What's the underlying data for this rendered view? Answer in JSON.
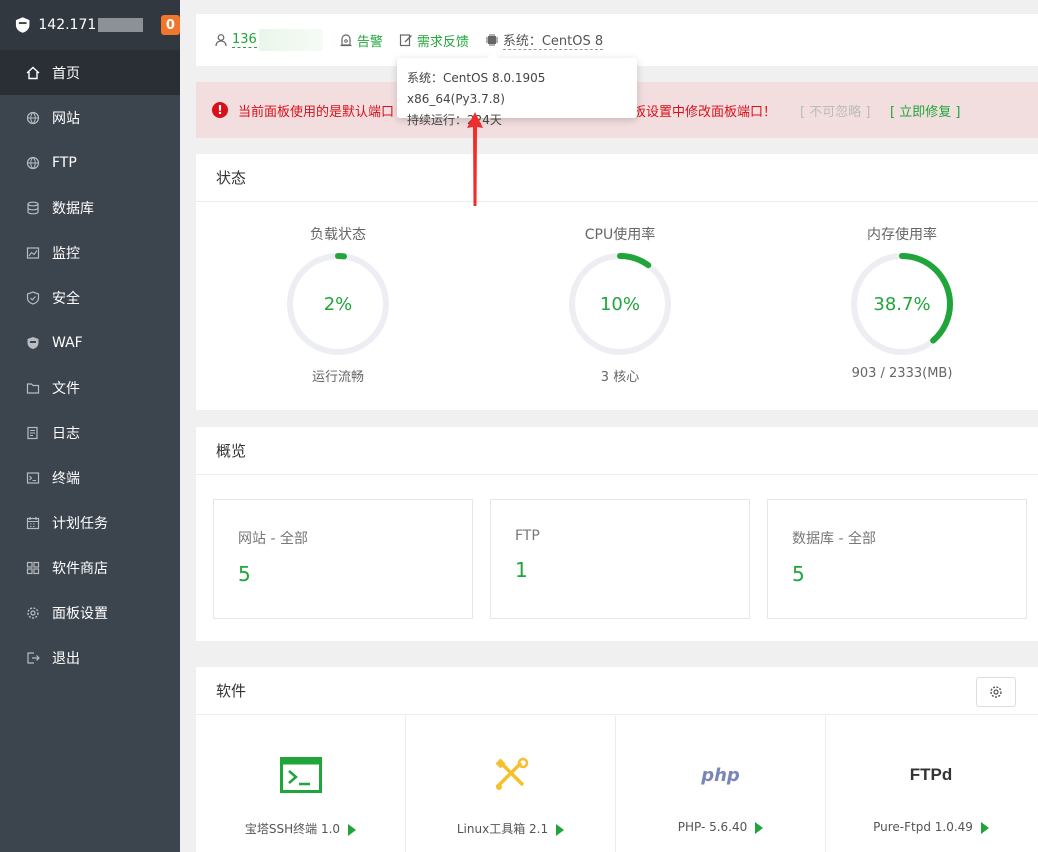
{
  "sidebar": {
    "ip": "142.171",
    "badge": "0",
    "items": [
      {
        "label": "首页",
        "icon": "home-icon"
      },
      {
        "label": "网站",
        "icon": "globe-icon"
      },
      {
        "label": "FTP",
        "icon": "globe-icon"
      },
      {
        "label": "数据库",
        "icon": "database-icon"
      },
      {
        "label": "监控",
        "icon": "monitor-icon"
      },
      {
        "label": "安全",
        "icon": "shield-icon"
      },
      {
        "label": "WAF",
        "icon": "waf-icon"
      },
      {
        "label": "文件",
        "icon": "folder-icon"
      },
      {
        "label": "日志",
        "icon": "log-icon"
      },
      {
        "label": "终端",
        "icon": "terminal-icon"
      },
      {
        "label": "计划任务",
        "icon": "calendar-icon"
      },
      {
        "label": "软件商店",
        "icon": "grid-icon"
      },
      {
        "label": "面板设置",
        "icon": "gear-icon"
      },
      {
        "label": "退出",
        "icon": "logout-icon"
      }
    ]
  },
  "topbar": {
    "user": "136",
    "alarm": "告警",
    "feedback": "需求反馈",
    "system": "系统：CentOS 8"
  },
  "tooltip": {
    "line1": "系统：CentOS 8.0.1905 x86_64(Py3.7.8)",
    "line2": "持续运行：224天"
  },
  "alert": {
    "text_a": "当前面板使用的是默认端口",
    "text_b": "板设置中修改面板端口！",
    "ignore": "[ 不可忽略 ]",
    "fix": "[ 立即修复 ]"
  },
  "status": {
    "title": "状态",
    "gauges": [
      {
        "label": "负载状态",
        "value": "2%",
        "percent": 2,
        "sub": "运行流畅"
      },
      {
        "label": "CPU使用率",
        "value": "10%",
        "percent": 10,
        "sub": "3 核心"
      },
      {
        "label": "内存使用率",
        "value": "38.7%",
        "percent": 38.7,
        "sub": "903 / 2333(MB)"
      }
    ]
  },
  "overview": {
    "title": "概览",
    "cards": [
      {
        "name": "网站 - 全部",
        "count": "5"
      },
      {
        "name": "FTP",
        "count": "1"
      },
      {
        "name": "数据库 - 全部",
        "count": "5"
      }
    ]
  },
  "software": {
    "title": "软件",
    "items": [
      {
        "name": "宝塔SSH终端 1.0",
        "icon": "ssh-terminal-icon"
      },
      {
        "name": "Linux工具箱 2.1",
        "icon": "toolbox-icon"
      },
      {
        "name": "PHP- 5.6.40",
        "icon": "php-icon",
        "logo_text": "php"
      },
      {
        "name": "Pure-Ftpd 1.0.49",
        "icon": "ftpd-icon",
        "logo_text": "FTPd"
      }
    ]
  },
  "colors": {
    "accent": "#20a53a",
    "sidebar": "#3c444d",
    "alert_bg": "#f2dede",
    "alert_text": "#d9101a",
    "badge": "#f0762b"
  }
}
